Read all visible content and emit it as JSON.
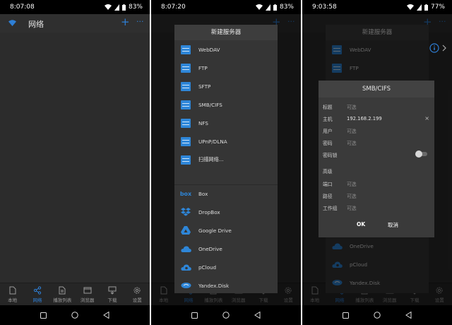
{
  "panels": [
    {
      "status_time": "8:07:08",
      "battery": "83%",
      "title": "网络"
    },
    {
      "status_time": "8:07:20",
      "battery": "83%"
    },
    {
      "status_time": "9:03:58",
      "battery": "77%"
    }
  ],
  "nav": {
    "items": [
      "本地",
      "网络",
      "播放列表",
      "浏览器",
      "下载",
      "设置"
    ]
  },
  "server_dialog": {
    "title": "新建服务器",
    "items": [
      "WebDAV",
      "FTP",
      "SFTP",
      "SMB/CIFS",
      "NFS",
      "UPnP/DLNA",
      "扫描网络..."
    ],
    "cloud_items": [
      "Box",
      "DropBox",
      "Google Drive",
      "OneDrive",
      "pCloud",
      "Yandex.Disk"
    ],
    "box_logo": "box"
  },
  "smb_dialog": {
    "title": "SMB/CIFS",
    "fields": [
      {
        "label": "标题",
        "value": "可选"
      },
      {
        "label": "主机",
        "value": "192.168.2.199"
      },
      {
        "label": "用户",
        "value": "可选"
      },
      {
        "label": "密码",
        "value": "可选"
      },
      {
        "label": "密码锁",
        "value": ""
      },
      {
        "label": "高级",
        "value": ""
      },
      {
        "label": "端口",
        "value": "可选"
      },
      {
        "label": "路径",
        "value": "可选"
      },
      {
        "label": "工作组",
        "value": "可选"
      }
    ],
    "ok": "OK",
    "cancel": "取消"
  },
  "colors": {
    "accent": "#2e7fd6",
    "background": "#2c2c2c",
    "dialog": "#353535"
  }
}
